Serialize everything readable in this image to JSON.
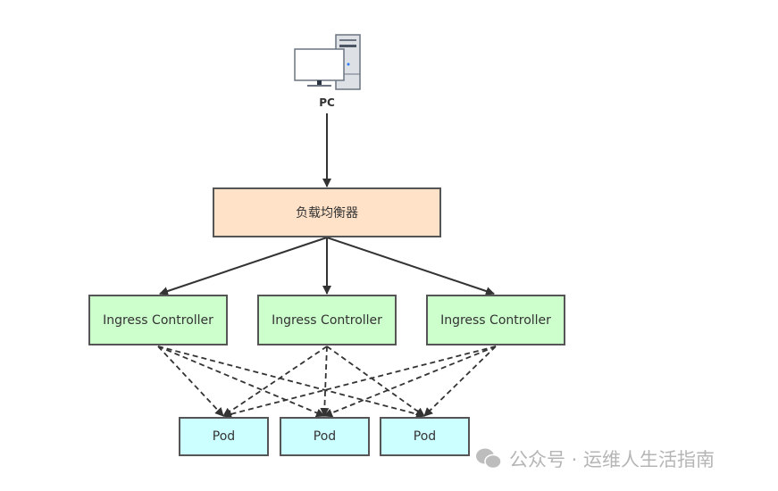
{
  "pc": {
    "label": "PC",
    "icon": "desktop-computer-icon"
  },
  "load_balancer": {
    "label": "负载均衡器",
    "color": "#ffe2c8"
  },
  "ingress_controllers": [
    {
      "label": "Ingress Controller"
    },
    {
      "label": "Ingress Controller"
    },
    {
      "label": "Ingress Controller"
    }
  ],
  "ingress_color": "#ccffcc",
  "pods": [
    {
      "label": "Pod"
    },
    {
      "label": "Pod"
    },
    {
      "label": "Pod"
    }
  ],
  "pod_color": "#ccffff",
  "watermark": {
    "text": "公众号 · 运维人生活指南",
    "icon": "wechat-icon"
  }
}
